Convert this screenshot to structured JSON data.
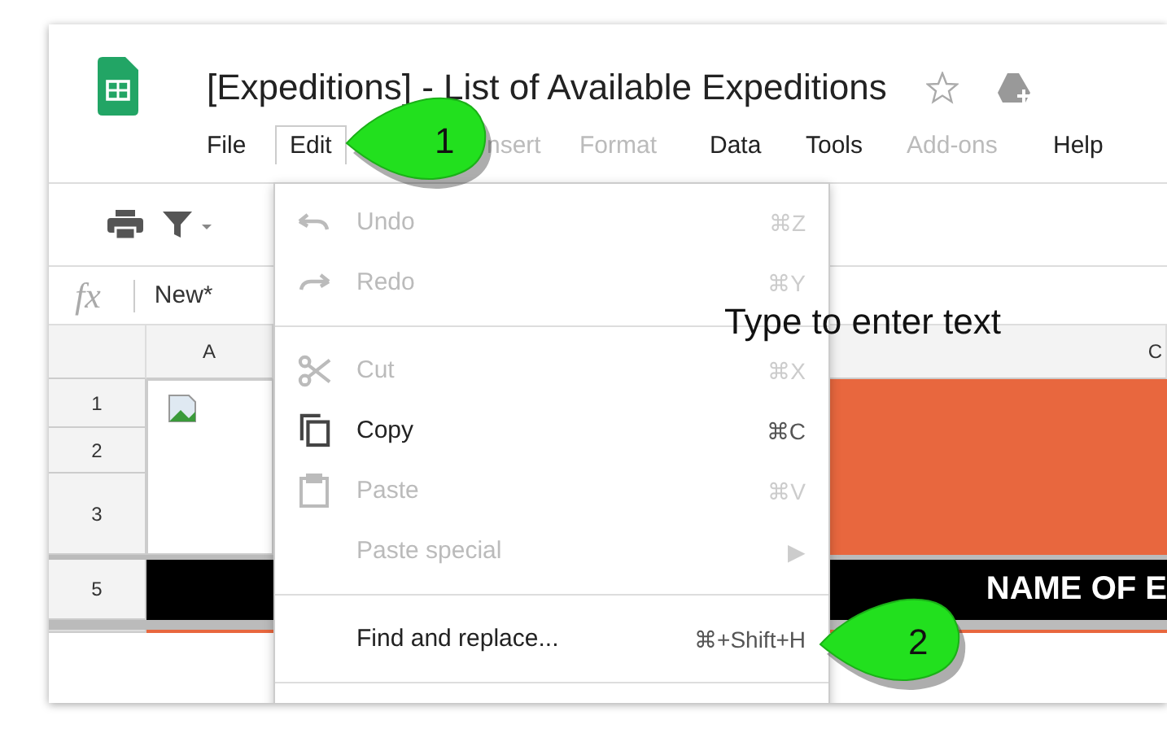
{
  "document": {
    "title": "[Expeditions] - List of Available Expeditions"
  },
  "menu_bar": [
    {
      "label": "File",
      "disabled": false,
      "selected": false
    },
    {
      "label": "Edit",
      "disabled": false,
      "selected": true
    },
    {
      "label": "nsert",
      "disabled": true,
      "selected": false
    },
    {
      "label": "Format",
      "disabled": true,
      "selected": false
    },
    {
      "label": "Data",
      "disabled": false,
      "selected": false
    },
    {
      "label": "Tools",
      "disabled": false,
      "selected": false
    },
    {
      "label": "Add-ons",
      "disabled": true,
      "selected": false
    },
    {
      "label": "Help",
      "disabled": false,
      "selected": false
    }
  ],
  "formula_bar": {
    "label": "fx",
    "value": "New*"
  },
  "grid": {
    "column_headers": [
      "A",
      "C"
    ],
    "row_headers": [
      "1",
      "2",
      "3",
      "5"
    ],
    "banner_text": "NAME OF E"
  },
  "edit_menu": {
    "items": [
      {
        "kind": "item",
        "label": "Undo",
        "shortcut": "⌘Z",
        "disabled": true
      },
      {
        "kind": "item",
        "label": "Redo",
        "shortcut": "⌘Y",
        "disabled": true
      },
      {
        "kind": "divider"
      },
      {
        "kind": "item",
        "label": "Cut",
        "shortcut": "⌘X",
        "disabled": true
      },
      {
        "kind": "item",
        "label": "Copy",
        "shortcut": "⌘C",
        "disabled": false
      },
      {
        "kind": "item",
        "label": "Paste",
        "shortcut": "⌘V",
        "disabled": true
      },
      {
        "kind": "item",
        "label": "Paste special",
        "shortcut": "▶",
        "disabled": true
      },
      {
        "kind": "divider"
      },
      {
        "kind": "item",
        "label": "Find and replace...",
        "shortcut": "⌘+Shift+H",
        "disabled": false
      },
      {
        "kind": "divider"
      }
    ]
  },
  "overlay_text": "Type to enter text",
  "callouts": [
    {
      "number": "1"
    },
    {
      "number": "2"
    }
  ]
}
